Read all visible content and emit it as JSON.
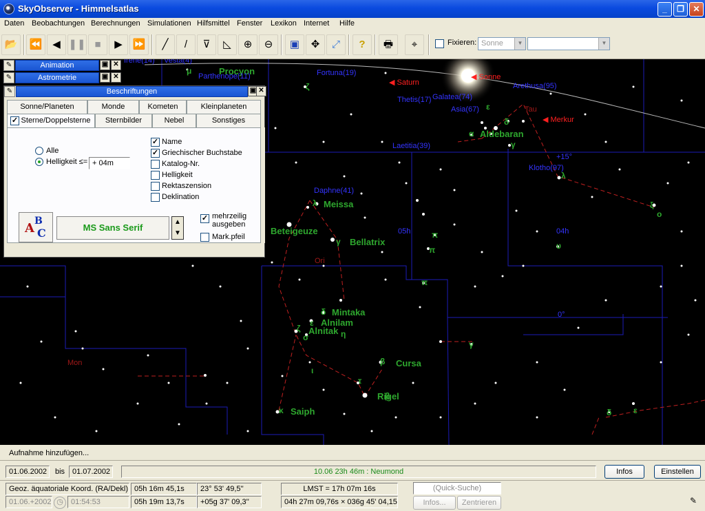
{
  "window": {
    "title": "SkyObserver - Himmelsatlas"
  },
  "menu": [
    "Daten",
    "Beobachtungen",
    "Berechnungen",
    "Simulationen",
    "Hilfsmittel",
    "Fenster",
    "Lexikon",
    "Internet",
    "Hilfe"
  ],
  "toolbar": {
    "fixieren_label": "Fixieren:",
    "fixieren_value": "Sonne",
    "fixieren_checked": false
  },
  "panels": {
    "animation": "Animation",
    "astrometrie": "Astrometrie",
    "beschriftungen": {
      "title": "Beschriftungen",
      "tabs_row1": [
        "Sonne/Planeten",
        "Monde",
        "Kometen",
        "Kleinplaneten"
      ],
      "tabs_row2": [
        "Sterne/Doppelsterne",
        "Sternbilder",
        "Nebel",
        "Sonstiges"
      ],
      "active_tab": "Sterne/Doppelsterne",
      "radio_alle": "Alle",
      "radio_helligkeit": "Helligkeit ≤=",
      "helligkeit_value": "+ 04m",
      "checkboxes": [
        {
          "label": "Name",
          "checked": true
        },
        {
          "label": "Griechischer Buchstabe",
          "checked": true
        },
        {
          "label": "Katalog-Nr.",
          "checked": false
        },
        {
          "label": "Helligkeit",
          "checked": false
        },
        {
          "label": "Rektaszension",
          "checked": false
        },
        {
          "label": "Deklination",
          "checked": false
        }
      ],
      "font_name": "MS Sans Serif",
      "mehrzeilig": "mehrzeilig ausgeben",
      "mehrzeilig_checked": true,
      "markpfeil": "Mark.pfeil",
      "markpfeil_checked": false
    }
  },
  "sky": {
    "labels_green": [
      "Meissa",
      "Beteigeuze",
      "Bellatrix",
      "Aldebaran",
      "Mintaka",
      "Alnilam",
      "Alnitak",
      "Cursa",
      "Rigel",
      "Saiph",
      "Procyon"
    ],
    "labels_blue": [
      "Fortuna(19)",
      "Parthenope(11)",
      "Thetis(17)",
      "Galatea(74)",
      "Asia(67)",
      "Arethusa(95)",
      "Laetitia(39)",
      "Klotho(97)",
      "Daphne(41)",
      "Vesta(4)",
      "Irene(14)",
      "05h",
      "04h",
      "+15°",
      "0°"
    ],
    "labels_red": [
      "Sonne",
      "Saturn",
      "Merkur"
    ],
    "labels_constellation": [
      "Tau",
      "Ori",
      "Mon"
    ],
    "greek": [
      "ζ",
      "ε",
      "δ",
      "α",
      "γ",
      "λ",
      "ξ",
      "ο",
      "γ",
      "π",
      "π",
      "π",
      "δ",
      "ε",
      "ζ",
      "σ",
      "η",
      "ι",
      "τ",
      "β",
      "κ",
      "β",
      "υ",
      "γ",
      "δ",
      "ε",
      "λ",
      "μ"
    ]
  },
  "statusbar": {
    "hint": "Aufnahme hinzufügen...",
    "date_from": "01.06.2002",
    "bis": "bis",
    "date_to": "01.07.2002",
    "event": "10.06  23h 46m :  Neumond",
    "infos_button": "Infos",
    "einstellen_button": "Einstellen",
    "coord_system": "Geoz. äquatoriale Koord. (RA/Dekl):",
    "ra1": "05h 16m 45,1s",
    "dec1": "23° 53' 49,5''",
    "ra2": "05h 19m 13,7s",
    "dec2": "+05g 37' 09,3''",
    "lmst": "LMST = 17h 07m 16s",
    "azalt": "04h 27m 09,76s × 036g 45' 04,15''",
    "date_field": "01.06.+2002",
    "time_field": "01:54:53",
    "quick_search": "(Quick-Suche)",
    "infos2": "Infos...",
    "zentrieren": "Zentrieren"
  }
}
